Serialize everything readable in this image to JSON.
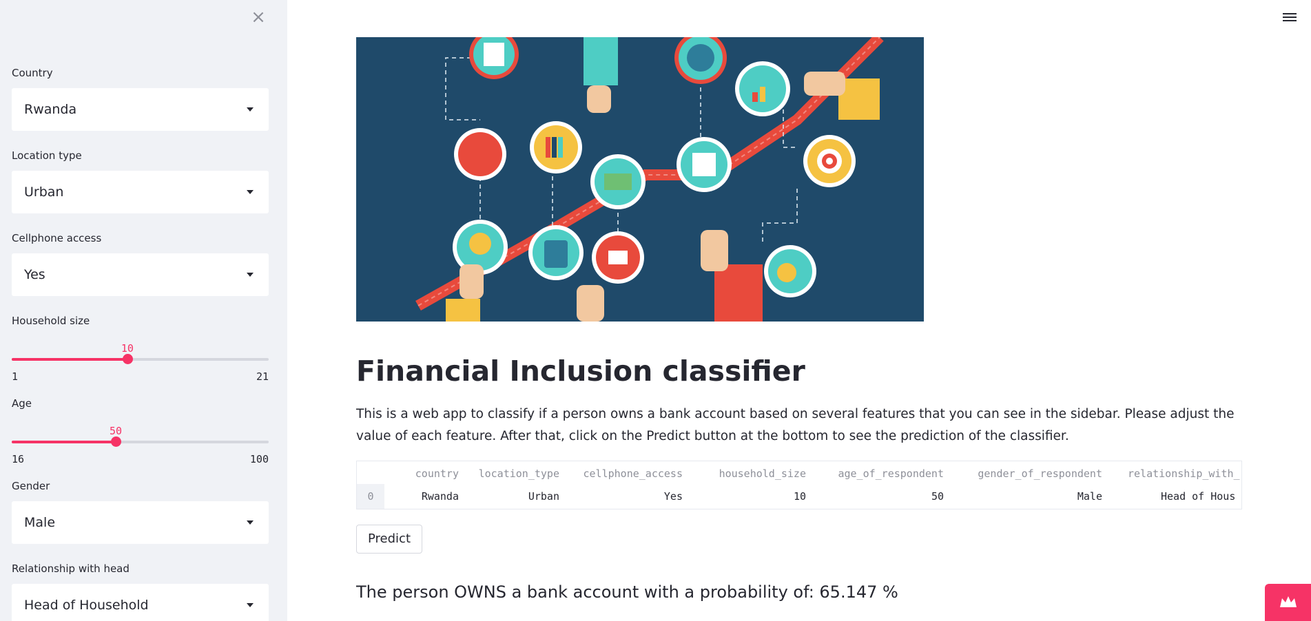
{
  "sidebar": {
    "close_icon": "×",
    "country": {
      "label": "Country",
      "value": "Rwanda"
    },
    "location": {
      "label": "Location type",
      "value": "Urban"
    },
    "cellphone": {
      "label": "Cellphone access",
      "value": "Yes"
    },
    "household": {
      "label": "Household size",
      "value": 10,
      "value_text": "10",
      "min": "1",
      "max": "21",
      "level": 0.45
    },
    "age": {
      "label": "Age",
      "value": 50,
      "value_text": "50",
      "min": "16",
      "max": "100",
      "level": 0.4048
    },
    "gender": {
      "label": "Gender",
      "value": "Male"
    },
    "relationship": {
      "label": "Relationship with head",
      "value": "Head of Household"
    }
  },
  "main": {
    "title": "Financial Inclusion classifier",
    "description": "This is a web app to classify if a person owns a bank account based on several features that you can see in the sidebar. Please adjust the value of each feature. After that, click on the Predict button at the bottom to see the prediction of the classifier.",
    "table": {
      "columns": [
        "country",
        "location_type",
        "cellphone_access",
        "household_size",
        "age_of_respondent",
        "gender_of_respondent",
        "relationship_with_"
      ],
      "rows": [
        {
          "index": "0",
          "cells": [
            "Rwanda",
            "Urban",
            "Yes",
            "10",
            "50",
            "Male",
            "Head of Hous"
          ]
        }
      ]
    },
    "predict_label": "Predict",
    "result": "The person OWNS a bank account with a probability of: 65.147 %"
  },
  "icons": {
    "menu": "hamburger-icon",
    "close": "close-icon",
    "badge": "crown-icon"
  },
  "colors": {
    "accent": "#f63366",
    "sidebar_bg": "#f0f2f6",
    "hero_bg": "#1f4a6a"
  }
}
